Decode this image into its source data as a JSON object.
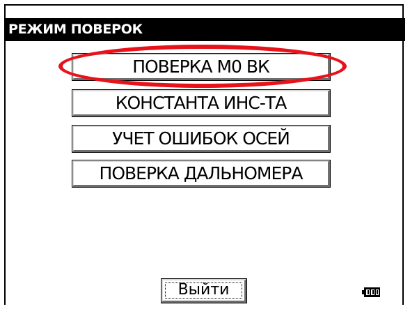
{
  "window": {
    "title": "РЕЖИМ ПОВЕРОК"
  },
  "menu": {
    "items": [
      {
        "label": "ПОВЕРКА М0 ВК"
      },
      {
        "label": "КОНСТАНТА ИНС-ТА"
      },
      {
        "label": "УЧЕТ ОШИБОК ОСЕЙ"
      },
      {
        "label": "ПОВЕРКА ДАЛЬНОМЕРА"
      }
    ]
  },
  "footer": {
    "exit_label": "Выйти"
  },
  "status": {
    "battery_icon": "battery-full-icon",
    "battery_level": 1.0
  },
  "colors": {
    "highlight": "#e8121b",
    "titlebar_bg": "#000000",
    "titlebar_fg": "#ffffff"
  }
}
